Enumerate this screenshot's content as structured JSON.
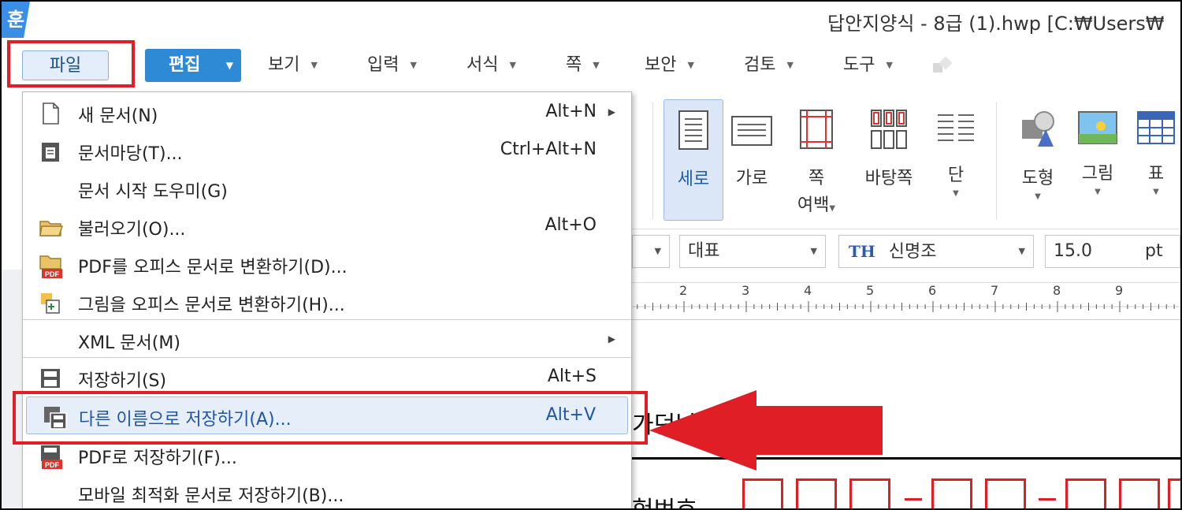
{
  "app": {
    "logo_char": "훈",
    "title": "답안지양식 - 8급 (1).hwp [C:₩Users₩"
  },
  "menubar": {
    "file": "파일",
    "edit": "편집",
    "items": [
      "보기",
      "입력",
      "서식",
      "쪽",
      "보안",
      "검토",
      "도구"
    ]
  },
  "file_menu": {
    "items": [
      {
        "label": "새 문서(N)",
        "shortcut": "Alt+N",
        "icon": "new-document-icon",
        "submenu": true
      },
      {
        "label": "문서마당(T)...",
        "shortcut": "Ctrl+Alt+N",
        "icon": "template-icon"
      },
      {
        "label": "문서 시작 도우미(G)",
        "shortcut": ""
      },
      {
        "label": "불러오기(O)...",
        "shortcut": "Alt+O",
        "icon": "open-folder-icon"
      },
      {
        "label": "PDF를 오피스 문서로 변환하기(D)...",
        "shortcut": "",
        "icon": "pdf-folder-icon"
      },
      {
        "label": "그림을 오피스 문서로 변환하기(H)...",
        "shortcut": "",
        "icon": "image-convert-icon"
      },
      {
        "label": "XML 문서(M)",
        "shortcut": "",
        "submenu": true
      },
      {
        "label": "저장하기(S)",
        "shortcut": "Alt+S",
        "icon": "save-icon"
      },
      {
        "label": "다른 이름으로 저장하기(A)...",
        "shortcut": "Alt+V",
        "icon": "save-as-icon",
        "highlighted": true
      },
      {
        "label": "PDF로 저장하기(F)...",
        "shortcut": "",
        "icon": "save-pdf-icon"
      },
      {
        "label": "모바일 최적화 문서로 저장하기(B)...",
        "shortcut": ""
      }
    ]
  },
  "ribbon": {
    "portrait": "세로",
    "landscape": "가로",
    "margin_line1": "쪽",
    "margin_line2": "여백",
    "page_bg": "바탕쪽",
    "columns": "단",
    "shape": "도형",
    "picture": "그림",
    "table": "표"
  },
  "format_bar": {
    "style": "대표",
    "font_icon": "TH",
    "font": "신명조",
    "size": "15.0",
    "unit": "pt"
  },
  "ruler": {
    "numbers": [
      "2",
      "3",
      "4",
      "5",
      "6",
      "7",
      "8",
      "9"
    ]
  },
  "document": {
    "line1_partial": "가던날",
    "line2_partial": "험번호"
  },
  "colors": {
    "accent": "#2f8ad6",
    "highlight": "#e01e26",
    "selection": "#e6eefa"
  }
}
